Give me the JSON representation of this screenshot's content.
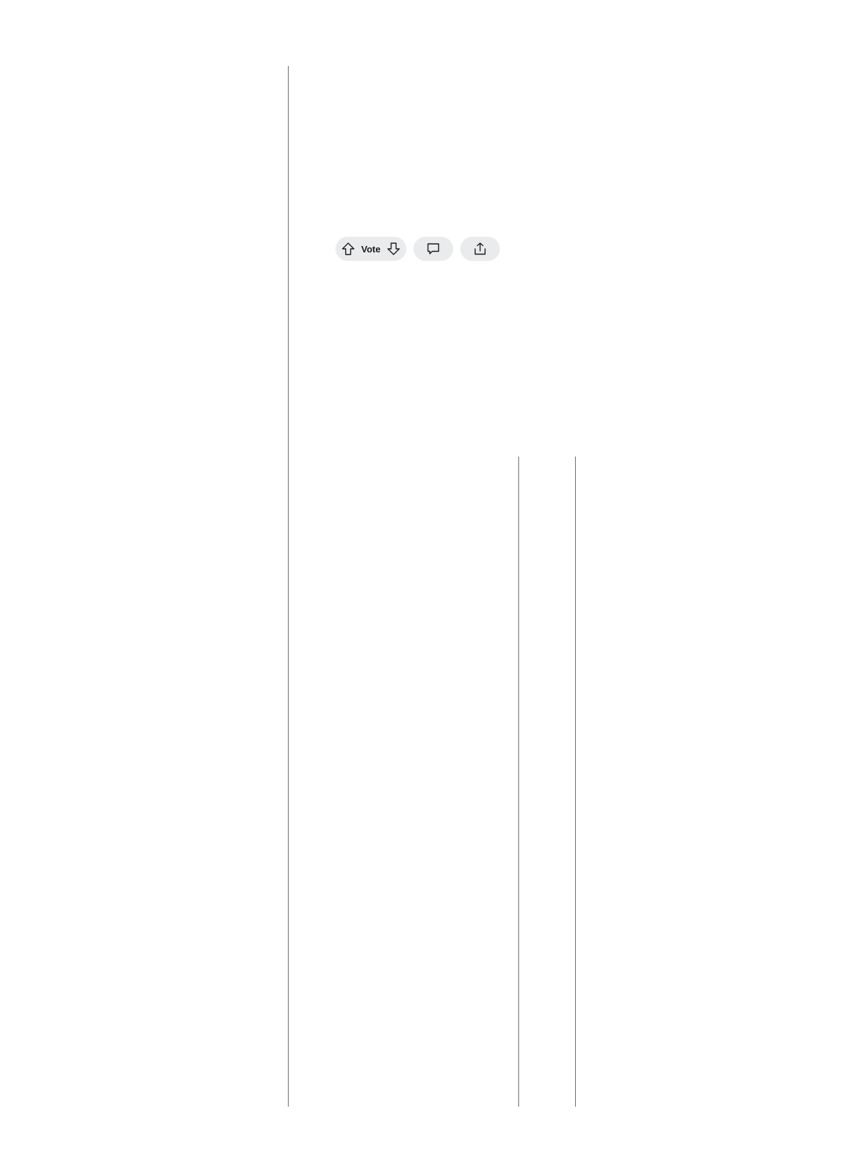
{
  "post_actions": {
    "vote_label": "Vote",
    "icons": {
      "upvote": "upvote-arrow-icon",
      "downvote": "downvote-arrow-icon",
      "comment": "comment-bubble-icon",
      "share": "share-upload-icon"
    }
  },
  "colors": {
    "pill_background": "#e9ebed",
    "divider": "#6b6b6b",
    "text": "#1a1a1b"
  }
}
